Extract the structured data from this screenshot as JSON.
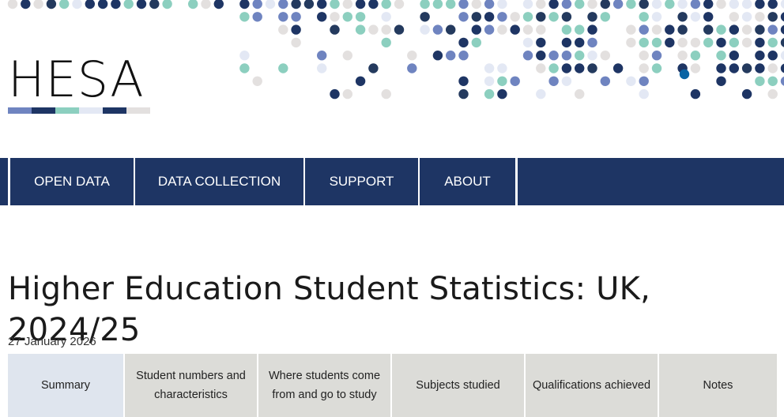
{
  "brand": {
    "name": "HESA",
    "colors": {
      "navy": "#1e3564",
      "periwinkle": "#6f84c0",
      "teal": "#8ccfbf",
      "light_grey": "#e3e0df",
      "pale_blue": "#e3e8f4",
      "dark": "#243a5e",
      "bright_blue": "#0a64a4"
    }
  },
  "nav": {
    "items": [
      {
        "label": "OPEN DATA"
      },
      {
        "label": "DATA COLLECTION"
      },
      {
        "label": "SUPPORT"
      },
      {
        "label": "ABOUT"
      }
    ]
  },
  "page": {
    "title": "Higher Education Student Statistics: UK, 2024/25",
    "date": "27 January 2026"
  },
  "tabs": [
    {
      "label": "Summary",
      "active": true
    },
    {
      "label": "Student numbers and characteristics",
      "active": false
    },
    {
      "label": "Where students come from and go to study",
      "active": false
    },
    {
      "label": "Subjects studied",
      "active": false
    },
    {
      "label": "Qualifications achieved",
      "active": false
    },
    {
      "label": "Notes",
      "active": false
    }
  ]
}
